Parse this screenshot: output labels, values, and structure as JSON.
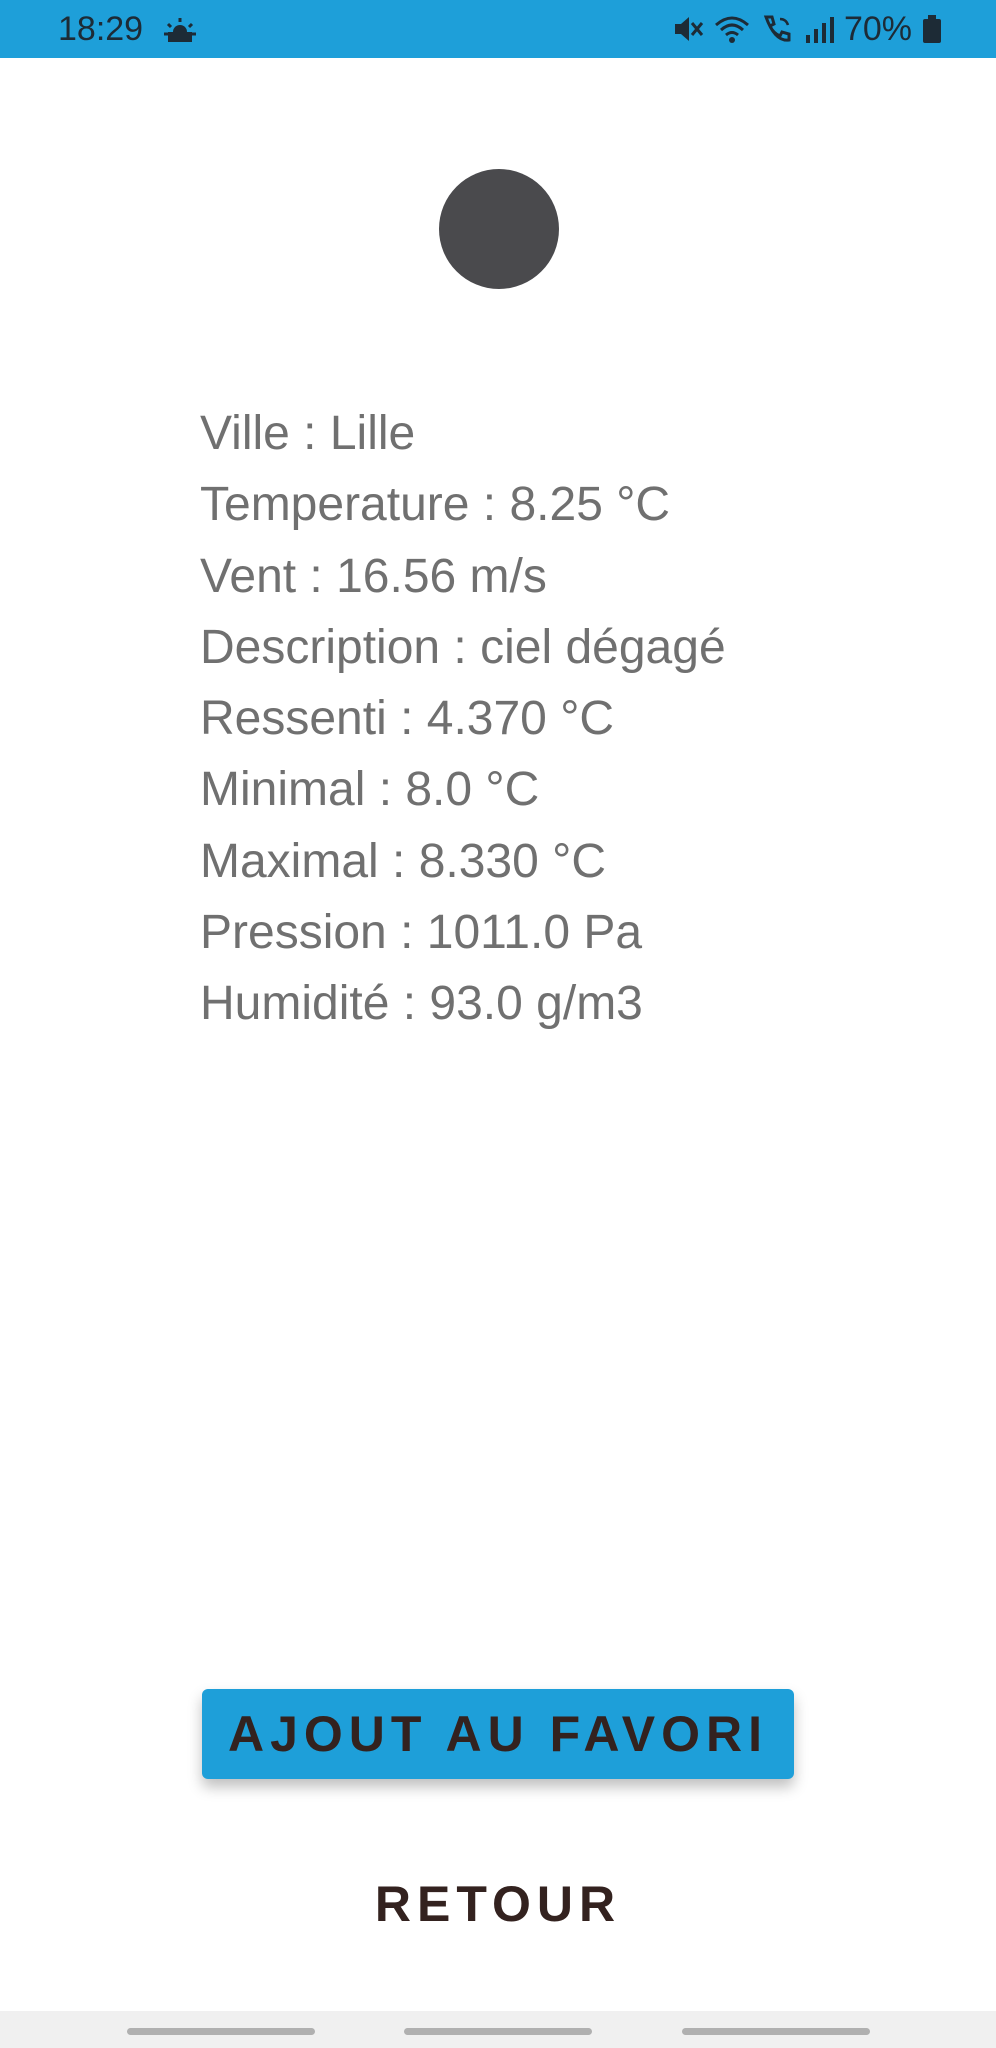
{
  "status_bar": {
    "time": "18:29",
    "battery": "70%",
    "icons": [
      "weather-sun-icon",
      "mute-icon",
      "wifi-icon",
      "wifi-call-icon",
      "signal-icon",
      "battery-icon"
    ],
    "background_color": "#1e9fd9"
  },
  "weather": {
    "icon": "weather-icon",
    "lines": [
      "Ville : Lille",
      "Temperature : 8.25 °C",
      "Vent : 16.56 m/s",
      "Description : ciel dégagé",
      "Ressenti : 4.370 °C",
      "Minimal : 8.0 °C",
      "Maximal : 8.330 °C",
      "Pression : 1011.0 Pa",
      "Humidité : 93.0 g/m3"
    ]
  },
  "actions": {
    "favorite_label": "AJOUT AU FAVORI",
    "back_label": "RETOUR",
    "accent_color": "#1e9fd9"
  }
}
